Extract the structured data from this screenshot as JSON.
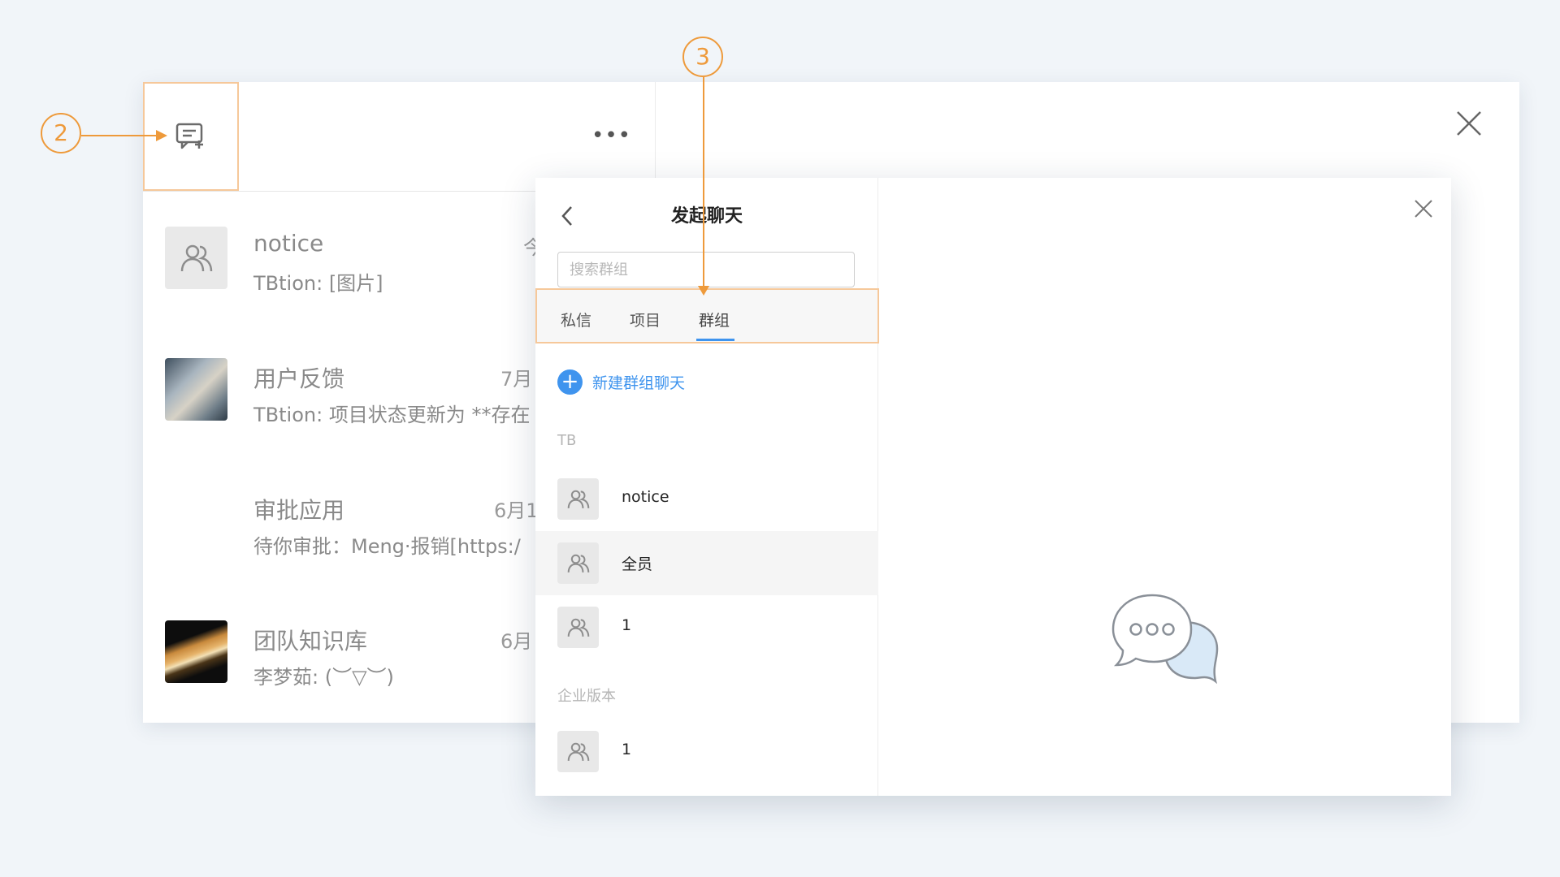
{
  "back_panel": {
    "more_label": "•••",
    "conversations": [
      {
        "name": "notice",
        "preview": "TBtion: [图片]",
        "time": "今",
        "avatar": "group-icon"
      },
      {
        "name": "用户反馈",
        "preview": "TBtion: 项目状态更新为 **存在",
        "time": "7月",
        "avatar": "mountain-photo"
      },
      {
        "name": "审批应用",
        "preview": "待你审批：Meng·报销[https:/",
        "time": "6月1",
        "avatar": "none"
      },
      {
        "name": "团队知识库",
        "preview": "李梦茹: (︶▽︶)",
        "time": "6月",
        "avatar": "planet-photo"
      }
    ]
  },
  "modal": {
    "title": "发起聊天",
    "search_placeholder": "搜索群组",
    "tabs": [
      "私信",
      "项目",
      "群组"
    ],
    "active_tab": "群组",
    "new_group_label": "新建群组聊天",
    "sections": [
      {
        "label": "TB",
        "groups": [
          "notice",
          "全员",
          "1"
        ]
      },
      {
        "label": "企业版本",
        "groups": [
          "1"
        ]
      }
    ],
    "highlighted_group": "全员"
  },
  "annotations": {
    "callout_2": "2",
    "callout_3": "3"
  },
  "colors": {
    "accent": "#3f94ee",
    "annotation": "#ee9a3b",
    "highlight_border": "#f6c89a",
    "background": "#f1f5f9"
  }
}
